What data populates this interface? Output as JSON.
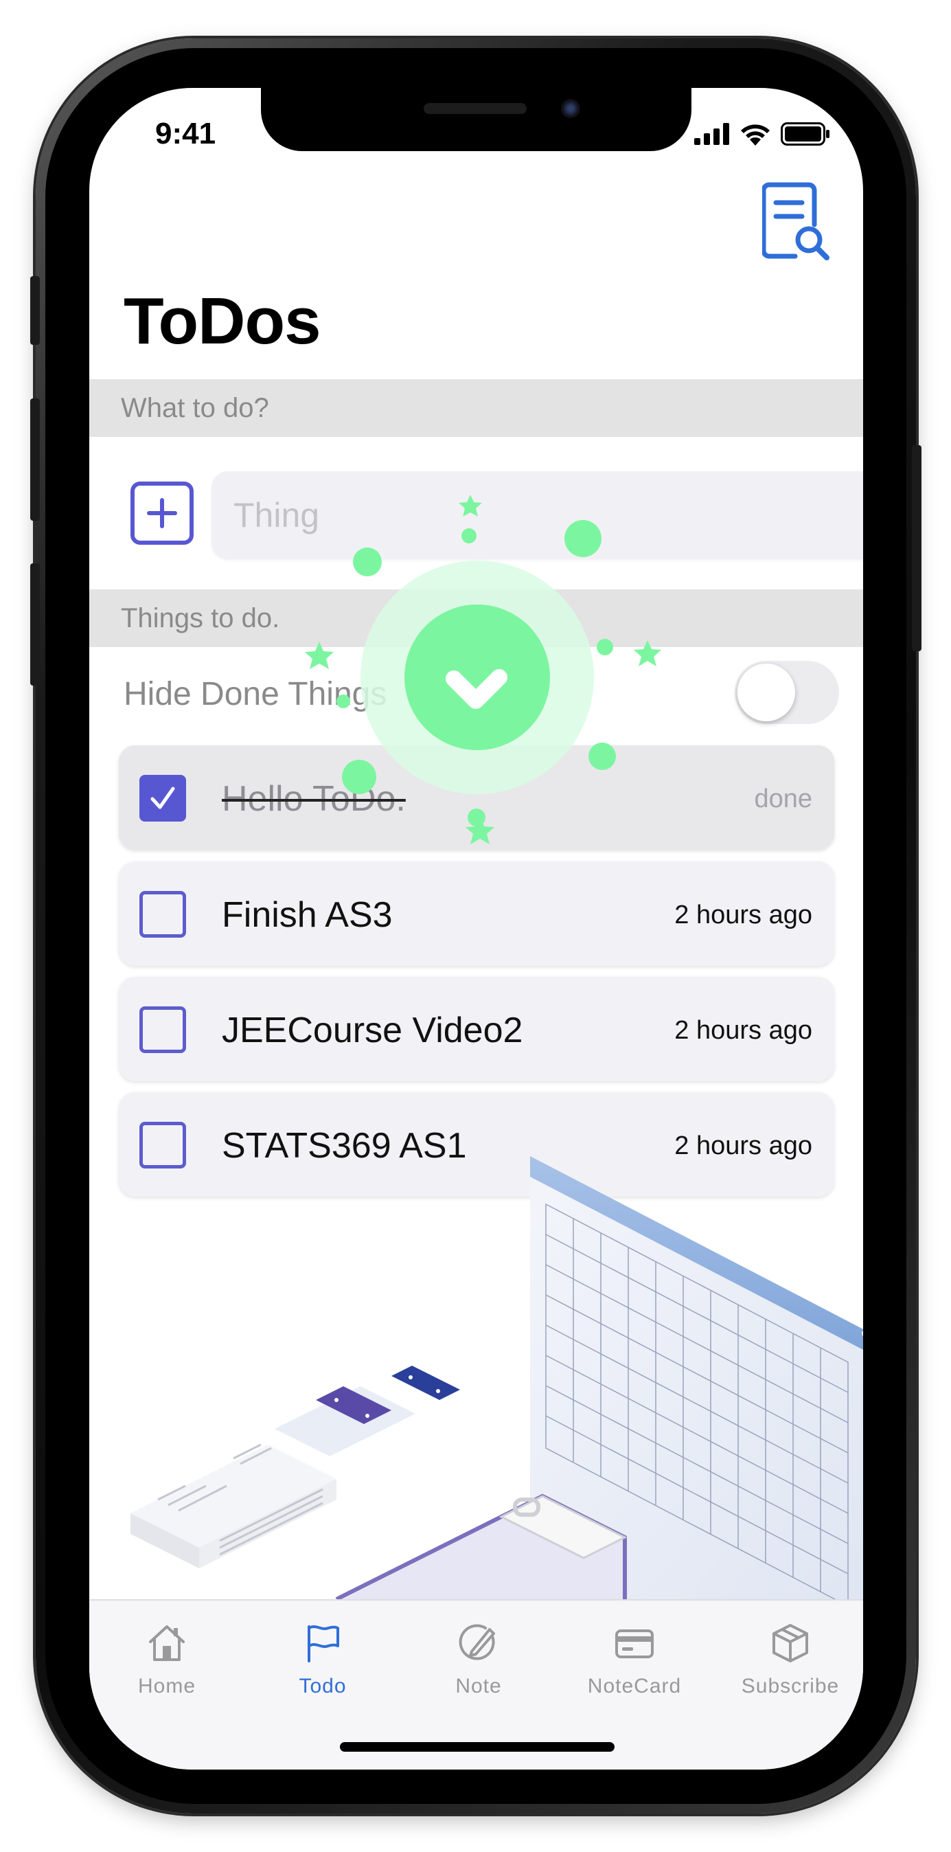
{
  "status_bar": {
    "time": "9:41"
  },
  "header": {
    "title": "ToDos",
    "search_icon": "document-search-icon"
  },
  "input_section": {
    "header": "What to do?",
    "add_icon": "plus-square-icon",
    "placeholder": "Thing",
    "value": ""
  },
  "list_section": {
    "header": "Things to do.",
    "hide_done_label": "Hide Done Things",
    "hide_done_enabled": false
  },
  "todos": [
    {
      "name": "Hello ToDo.",
      "time": "done",
      "checked": true
    },
    {
      "name": "Finish AS3",
      "time": "2 hours ago",
      "checked": false
    },
    {
      "name": "JEECourse Video2",
      "time": "2 hours ago",
      "checked": false
    },
    {
      "name": "STATS369 AS1",
      "time": "2 hours ago",
      "checked": false
    }
  ],
  "tabbar": {
    "active": "Todo",
    "tabs": [
      {
        "label": "Home",
        "icon": "house-icon"
      },
      {
        "label": "Todo",
        "icon": "flag-icon"
      },
      {
        "label": "Note",
        "icon": "pencil-circle-icon"
      },
      {
        "label": "NoteCard",
        "icon": "card-icon"
      },
      {
        "label": "Subscribe",
        "icon": "box-icon"
      }
    ]
  },
  "colors": {
    "accent": "#5857d2",
    "tab_active": "#2f6ed8",
    "celebration": "#7cf5a0"
  }
}
